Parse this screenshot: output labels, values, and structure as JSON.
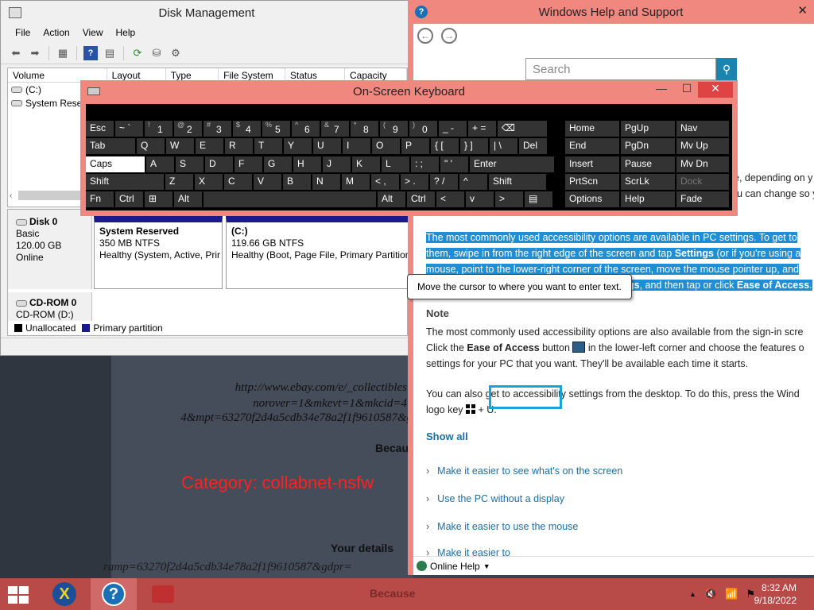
{
  "background_page": {
    "url_lines": [
      "http://www.ebay.com/e/_collectibles",
      "norover=1&mkevt=1&mkcid=4",
      "4&mpt=63270f2d4a5cdb34e78a2f1f9610587&gdpr="
    ],
    "because": "Becau",
    "category": "Category: collabnet-nsfw",
    "your_details": "Your details",
    "bottom_line": "ramp=63270f2d4a5cdb34e78a2f1f9610587&gdpr="
  },
  "disk_mgmt": {
    "title": "Disk Management",
    "menu": [
      "File",
      "Action",
      "View",
      "Help"
    ],
    "columns": [
      "Volume",
      "Layout",
      "Type",
      "File System",
      "Status",
      "Capacity"
    ],
    "volumes": [
      {
        "name": "(C:)"
      },
      {
        "name": "System Reser"
      }
    ],
    "disks": [
      {
        "name": "Disk 0",
        "type": "Basic",
        "size": "120.00 GB",
        "status": "Online"
      },
      {
        "name": "CD-ROM 0",
        "type": "CD-ROM (D:)"
      }
    ],
    "partitions": [
      {
        "name": "System Reserved",
        "size": "350 MB NTFS",
        "health": "Healthy (System, Active, Prir"
      },
      {
        "name": "(C:)",
        "size": "119.66 GB NTFS",
        "health": "Healthy (Boot, Page File, Primary Partition)"
      }
    ],
    "legend": [
      {
        "label": "Unallocated",
        "color": "#000000"
      },
      {
        "label": "Primary partition",
        "color": "#1a1a8c"
      }
    ]
  },
  "help": {
    "title": "Windows Help and Support",
    "search_placeholder": "Search",
    "cut_line1": "e, depending on y",
    "cut_line2": "u can change so y",
    "hl_p1": "The most commonly used accessibility options are available in PC settings. To get to",
    "hl_p2a": "them, swipe in from the right edge of the screen and tap ",
    "hl_p2b": "Settings",
    "hl_p2c": " (or if you're using a",
    "hl_p3": "mouse, point to the lower-right corner of the screen, move the mouse pointer up, and",
    "hl_p4a": "gs",
    "hl_p4b": ", and then tap or click ",
    "hl_p4c": "Ease of Access",
    "hl_p4d": ".",
    "note_title": "Note",
    "note_l1": "The most commonly used accessibility options are also available from the sign-in scre",
    "note_l2a": "Click the ",
    "note_l2b": "Ease of Access",
    "note_l2c": " button ",
    "note_l2d": " in the lower-left corner and choose the features o",
    "note_l3": "settings for your PC that you want. They'll be available each time it starts.",
    "desk_l1": "You can also get to accessibility settings from the desktop. To do this, press the Wind",
    "desk_l2a": "logo key ",
    "desk_l2b": " + U.",
    "show_all": "Show all",
    "expanders": [
      "Make it easier to see what's on the screen",
      "Use the PC without a display",
      "Make it easier to use the mouse",
      "Make it easier to"
    ],
    "footer": "Online Help"
  },
  "tooltip": "Move the cursor to where you want to enter text.",
  "osk": {
    "title": "On-Screen Keyboard",
    "rows": [
      [
        {
          "l": "Esc"
        },
        {
          "l": "~ `"
        },
        {
          "s": "!",
          "l": "1"
        },
        {
          "s": "@",
          "l": "2"
        },
        {
          "s": "#",
          "l": "3"
        },
        {
          "s": "$",
          "l": "4"
        },
        {
          "s": "%",
          "l": "5"
        },
        {
          "s": "^",
          "l": "6"
        },
        {
          "s": "&",
          "l": "7"
        },
        {
          "s": "*",
          "l": "8"
        },
        {
          "s": "(",
          "l": "9"
        },
        {
          "s": ")",
          "l": "0"
        },
        {
          "l": "_ -"
        },
        {
          "l": "+ ="
        },
        {
          "l": "⌫"
        }
      ],
      [
        {
          "l": "Tab"
        },
        {
          "l": "Q"
        },
        {
          "l": "W"
        },
        {
          "l": "E"
        },
        {
          "l": "R"
        },
        {
          "l": "T"
        },
        {
          "l": "Y"
        },
        {
          "l": "U"
        },
        {
          "l": "I"
        },
        {
          "l": "O"
        },
        {
          "l": "P"
        },
        {
          "l": "{ ["
        },
        {
          "l": "} ]"
        },
        {
          "l": "| \\"
        },
        {
          "l": "Del"
        }
      ],
      [
        {
          "l": "Caps"
        },
        {
          "l": "A"
        },
        {
          "l": "S"
        },
        {
          "l": "D"
        },
        {
          "l": "F"
        },
        {
          "l": "G"
        },
        {
          "l": "H"
        },
        {
          "l": "J"
        },
        {
          "l": "K"
        },
        {
          "l": "L"
        },
        {
          "l": ": ;"
        },
        {
          "l": "\" '"
        },
        {
          "l": "Enter"
        }
      ],
      [
        {
          "l": "Shift"
        },
        {
          "l": "Z"
        },
        {
          "l": "X"
        },
        {
          "l": "C"
        },
        {
          "l": "V"
        },
        {
          "l": "B"
        },
        {
          "l": "N"
        },
        {
          "l": "M"
        },
        {
          "l": "< ,"
        },
        {
          "l": "> ."
        },
        {
          "l": "? /"
        },
        {
          "l": "^"
        },
        {
          "l": "Shift"
        }
      ],
      [
        {
          "l": "Fn"
        },
        {
          "l": "Ctrl"
        },
        {
          "l": "⊞"
        },
        {
          "l": "Alt"
        },
        {
          "l": ""
        },
        {
          "l": "Alt"
        },
        {
          "l": "Ctrl"
        },
        {
          "l": "<"
        },
        {
          "l": "v"
        },
        {
          "l": ">"
        },
        {
          "l": "▤"
        }
      ]
    ],
    "nav_keys": [
      [
        "Home",
        "PgUp",
        "Nav"
      ],
      [
        "End",
        "PgDn",
        "Mv Up"
      ],
      [
        "Insert",
        "Pause",
        "Mv Dn"
      ],
      [
        "PrtScn",
        "ScrLk",
        "Dock"
      ],
      [
        "Options",
        "Help",
        "Fade"
      ]
    ],
    "active_key": "Caps",
    "disabled_key": "Dock"
  },
  "taskbar": {
    "center_text": "Because",
    "time": "8:32 AM",
    "date": "9/18/2022",
    "help_glyph": "?",
    "x_glyph": "X",
    "up_arrow": "▲",
    "volume_icon": "🔇",
    "network_icon": "📶",
    "flag_icon": "⚑"
  }
}
